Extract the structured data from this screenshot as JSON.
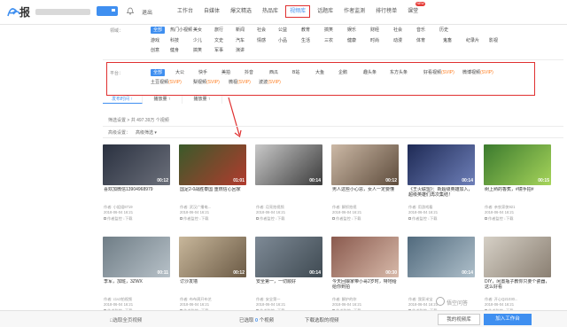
{
  "header": {
    "logo_text": "报",
    "logout_label": "退出",
    "nav": [
      {
        "label": "工作台",
        "active": false
      },
      {
        "label": "自媒体",
        "active": false
      },
      {
        "label": "爆文精选",
        "active": false
      },
      {
        "label": "热品库",
        "active": false
      },
      {
        "label": "视频库",
        "active": true
      },
      {
        "label": "话题库",
        "active": false
      },
      {
        "label": "作者监测",
        "active": false
      },
      {
        "label": "排行榜单",
        "active": false
      },
      {
        "label": "课堂",
        "active": false,
        "badge": "NEW"
      }
    ]
  },
  "filters": {
    "category": {
      "label": "领域：",
      "row1": [
        "全部",
        "热门小视频",
        "美女",
        "旅行",
        "新闻",
        "社会",
        "公益",
        "教育",
        "搞笑",
        "娱乐",
        "财经",
        "社会",
        "音乐",
        "历史"
      ],
      "row2": [
        "游戏",
        "科技",
        "少儿",
        "文史",
        "汽车",
        "情感",
        "小品",
        "生活",
        "三农",
        "健康",
        "时尚",
        "动漫",
        "体育",
        "鬼畜",
        "纪录片",
        "影视"
      ],
      "row3": [
        "创意",
        "健身",
        "搞笑",
        "军事",
        "演讲"
      ]
    },
    "platform": {
      "label": "平台：",
      "row1": [
        {
          "label": "全部",
          "svip": ""
        },
        {
          "label": "大公",
          "svip": ""
        },
        {
          "label": "快手",
          "svip": ""
        },
        {
          "label": "美拍",
          "svip": ""
        },
        {
          "label": "抖音",
          "svip": ""
        },
        {
          "label": "西瓜",
          "svip": ""
        },
        {
          "label": "B站",
          "svip": ""
        },
        {
          "label": "大鱼",
          "svip": ""
        },
        {
          "label": "企鹅",
          "svip": ""
        },
        {
          "label": "趣头条",
          "svip": ""
        },
        {
          "label": "东方头条",
          "svip": ""
        },
        {
          "label": "好看视频",
          "svip": "(SVIP)"
        },
        {
          "label": "微博视频",
          "svip": "(SVIP)"
        }
      ],
      "row2": [
        {
          "label": "土豆视频",
          "svip": "(SVIP)"
        },
        {
          "label": "梨视频",
          "svip": "(SVIP)"
        },
        {
          "label": "微视",
          "svip": "(SVIP)"
        },
        {
          "label": "波波",
          "svip": "(SVIP)"
        }
      ]
    },
    "sort_tabs": [
      {
        "label": "发布时间 ↑",
        "active": true
      },
      {
        "label": "播放量 ↑",
        "active": false
      },
      {
        "label": "播放量 ↑",
        "active": false
      }
    ],
    "result_info": "筛选设置 > 共 497.39万 个视频",
    "advanced_label": "高级设置：",
    "advanced_btn": "高级筛选 ▾"
  },
  "cards": [
    {
      "title": "喜欢加微信13904968979",
      "duration": "00:12",
      "author": "作者: 小姐姐8719",
      "date": "2018-06-04 16:21",
      "actions": "作者监控  ↓下载",
      "plays": "0"
    },
    {
      "title": "国足2-0战胜泰国 重燃信心回家",
      "duration": "01:01",
      "author": "作者: 武汉广播电...",
      "date": "2018-06-04 16:21",
      "actions": "作者监控  ↓下载",
      "plays": "0"
    },
    {
      "title": "",
      "duration": "00:14",
      "author": "作者: 月亮拍视频",
      "date": "2018-06-04 16:21",
      "actions": "作者监控  ↓下载",
      "plays": "0"
    },
    {
      "title": "男人这些小心思，女人一定要懂",
      "duration": "00:12",
      "author": "作者: 解抓拍视",
      "date": "2018-06-04 16:21",
      "actions": "作者监控  ↓下载",
      "plays": "0"
    },
    {
      "title": "《王火联盟》：新超级英雄加入，超级英雄们再次集结！",
      "duration": "00:14",
      "author": "作者: 用游戏看",
      "date": "2018-06-04 16:21",
      "actions": "作者监控  ↓下载",
      "plays": "0"
    },
    {
      "title": "树上熟的香蕉，#镜手拍#",
      "duration": "00:15",
      "author": "作者: 亲农家侠921",
      "date": "2018-06-04 16:21",
      "actions": "作者监控  ↓下载",
      "plays": "0"
    },
    {
      "title": "李军，加班，3ZWX",
      "duration": "00:11",
      "author": "作者: c1v2拍视频",
      "date": "2018-06-04 16:21",
      "actions": "作者监控  ↓下载",
      "plays": "0"
    },
    {
      "title": "订沙发墙",
      "duration": "00:12",
      "author": "作者: 布布周开布艺",
      "date": "2018-06-04 16:21",
      "actions": "作者监控  ↓下载",
      "plays": "0"
    },
    {
      "title": "安全第一，一切顺好",
      "duration": "00:14",
      "author": "作者: 安全第一",
      "date": "2018-06-04 16:21",
      "actions": "作者监控  ↓下载",
      "plays": "0"
    },
    {
      "title": "今天回娘家带小哥2岁时，特地给给你到拍",
      "duration": "00:30",
      "author": "作者: 解护的你",
      "date": "2018-06-04 16:21",
      "actions": "作者监控  ↓下载",
      "plays": "0"
    },
    {
      "title": "",
      "duration": "00:14",
      "author": "作者: 我家米宝",
      "date": "2018-06-04 16:21",
      "actions": "作者监控  ↓下载",
      "plays": "0"
    },
    {
      "title": "DIY，闲置瓶子教你只要个瓷器，这么好看",
      "duration": "",
      "author": "作者: 开心Q21030...",
      "date": "2018-06-04 16:21",
      "actions": "作者监控  ↓下载",
      "plays": "0"
    }
  ],
  "bottom": {
    "select_page": "□选取全页视频",
    "selected_prefix": "已选取",
    "selected_count": "0",
    "selected_suffix": "个视频",
    "download_label": "下载选取的视频",
    "library_label": "我的视频库",
    "add_label": "加入工作台"
  },
  "watermark": "悟空问答"
}
